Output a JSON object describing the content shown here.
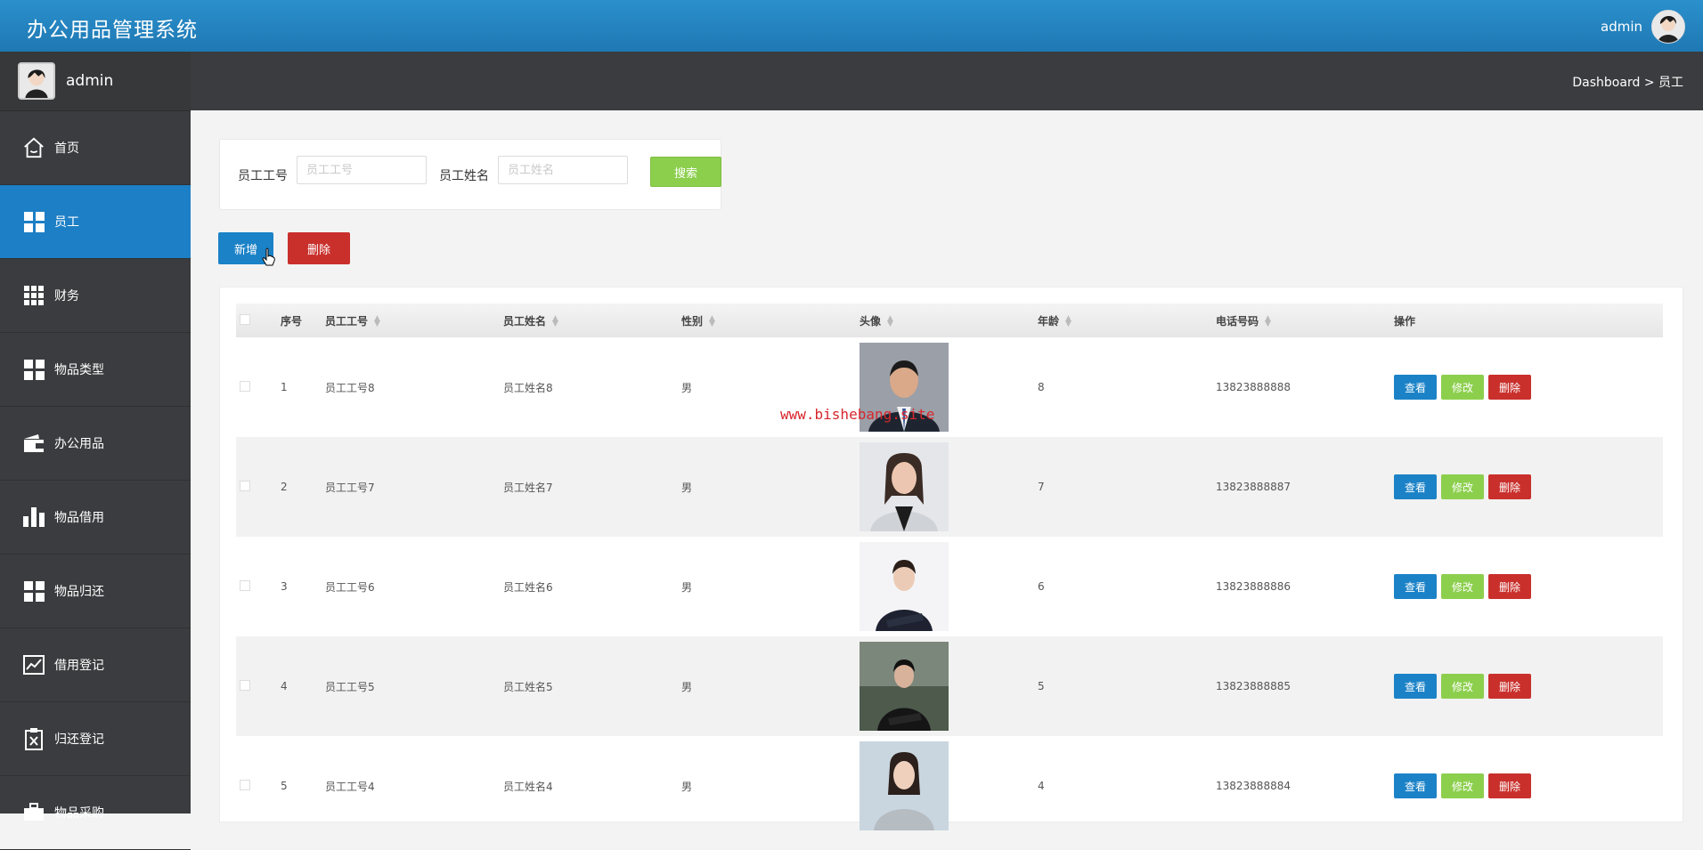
{
  "app": {
    "title": "办公用品管理系统",
    "user": "admin"
  },
  "sidebar": {
    "user": "admin",
    "items": [
      {
        "label": "首页",
        "icon": "home-icon"
      },
      {
        "label": "员工",
        "icon": "grid-icon",
        "active": true
      },
      {
        "label": "财务",
        "icon": "grid-small-icon"
      },
      {
        "label": "物品类型",
        "icon": "grid-icon"
      },
      {
        "label": "办公用品",
        "icon": "wallet-icon"
      },
      {
        "label": "物品借用",
        "icon": "bar-chart-icon"
      },
      {
        "label": "物品归还",
        "icon": "grid-icon"
      },
      {
        "label": "借用登记",
        "icon": "trend-icon"
      },
      {
        "label": "归还登记",
        "icon": "clipboard-x-icon"
      },
      {
        "label": "物品采购",
        "icon": "briefcase-icon"
      }
    ]
  },
  "breadcrumb": {
    "root": "Dashboard",
    "sep": ">",
    "current": "员工"
  },
  "search": {
    "id_label": "员工工号",
    "id_placeholder": "员工工号",
    "name_label": "员工姓名",
    "name_placeholder": "员工姓名",
    "button": "搜索"
  },
  "actions": {
    "add": "新增",
    "delete": "删除"
  },
  "table": {
    "headers": {
      "index": "序号",
      "emp_id": "员工工号",
      "emp_name": "员工姓名",
      "gender": "性别",
      "avatar": "头像",
      "age": "年龄",
      "phone": "电话号码",
      "ops": "操作"
    },
    "rows": [
      {
        "index": "1",
        "emp_id": "员工工号8",
        "emp_name": "员工姓名8",
        "gender": "男",
        "age": "8",
        "phone": "13823888888"
      },
      {
        "index": "2",
        "emp_id": "员工工号7",
        "emp_name": "员工姓名7",
        "gender": "男",
        "age": "7",
        "phone": "13823888887"
      },
      {
        "index": "3",
        "emp_id": "员工工号6",
        "emp_name": "员工姓名6",
        "gender": "男",
        "age": "6",
        "phone": "13823888886"
      },
      {
        "index": "4",
        "emp_id": "员工工号5",
        "emp_name": "员工姓名5",
        "gender": "男",
        "age": "5",
        "phone": "13823888885"
      },
      {
        "index": "5",
        "emp_id": "员工工号4",
        "emp_name": "员工姓名4",
        "gender": "男",
        "age": "4",
        "phone": "13823888884"
      }
    ],
    "row_buttons": {
      "view": "查看",
      "edit": "修改",
      "delete": "删除"
    }
  },
  "watermark": "www.bishebang.site",
  "colors": {
    "primary": "#1b82c7",
    "success": "#8ccf4d",
    "danger": "#c9302c",
    "sidebar": "#3a3c3f"
  }
}
